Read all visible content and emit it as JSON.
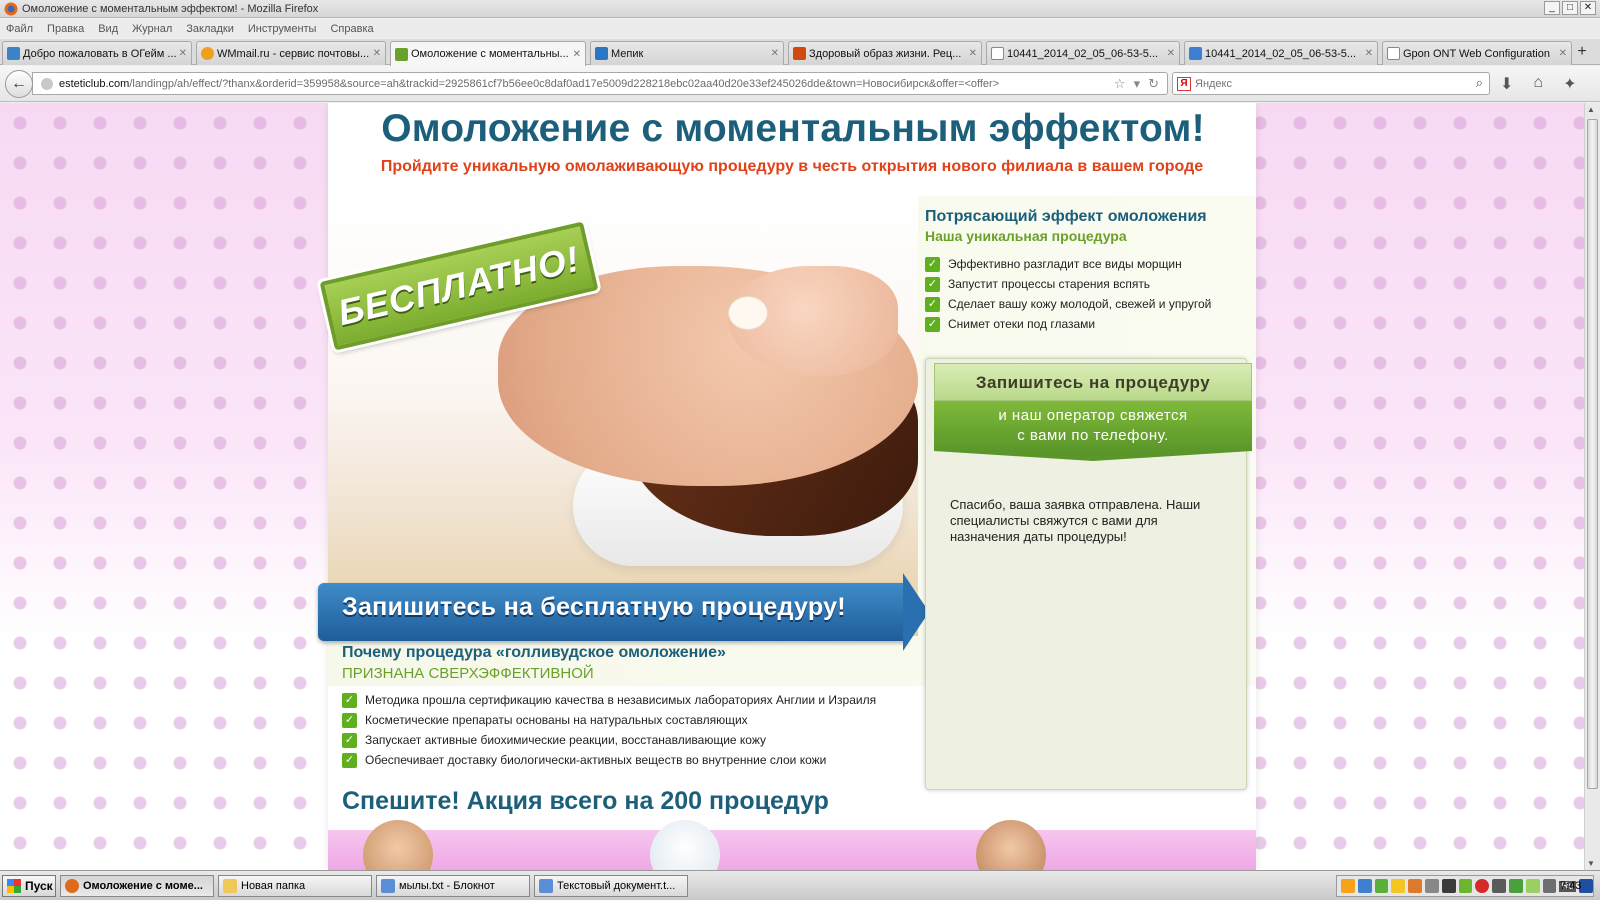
{
  "window": {
    "title": "Омоложение с моментальным эффектом! - Mozilla Firefox"
  },
  "menu": [
    "Файл",
    "Правка",
    "Вид",
    "Журнал",
    "Закладки",
    "Инструменты",
    "Справка"
  ],
  "tabs": [
    {
      "label": "Добро пожаловать в ОГейм ...",
      "color": "#3b83c7",
      "active": false
    },
    {
      "label": "WMmail.ru - сервис почтовы...",
      "color": "#f0a020",
      "active": false
    },
    {
      "label": "Омоложение с моментальны...",
      "color": "#6aa12a",
      "active": true
    },
    {
      "label": "Мепик",
      "color": "#2b75c5",
      "active": false
    },
    {
      "label": "Здоровый образ жизни. Рец...",
      "color": "#d04a10",
      "active": false
    },
    {
      "label": "10441_2014_02_05_06-53-5...",
      "color": "#cccccc",
      "active": false
    },
    {
      "label": "10441_2014_02_05_06-53-5...",
      "color": "#3d7fd1",
      "active": false
    },
    {
      "label": "Gpon ONT Web Configuration",
      "color": "#cccccc",
      "active": false
    }
  ],
  "nav": {
    "domain": "esteticlub.com",
    "path": "/landingp/ah/effect/?thanx&orderid=359958&source=ah&trackid=2925861cf7b56ee0c8daf0ad17e5009d228218ebc02aa40d20e33ef245026dde&town=Новосибирск&offer=<offer>",
    "search_placeholder": "Яндекс",
    "yandex_letter": "Я"
  },
  "page": {
    "headline": "Омоложение с моментальным эффектом!",
    "subline": "Пройдите уникальную омолаживающую процедуру в честь открытия нового филиала в вашем городе",
    "stamp": "БЕСПЛАТНО!",
    "effect_title": "Потрясающий эффект омоложения",
    "effect_subtitle": "Наша уникальная процедура",
    "benefits": [
      "Эффективно разгладит все виды морщин",
      "Запустит процессы старения вспять",
      "Сделает вашу кожу молодой, свежей и упругой",
      "Снимет отеки под глазами"
    ],
    "banner": "Запишитесь на бесплатную процедуру!",
    "form": {
      "title": "Запишитесь на процедуру",
      "subtitle_line1": "и наш оператор свяжется",
      "subtitle_line2": "с вами по телефону.",
      "thanks": "Спасибо, ваша заявка отправлена. Наши специалисты свяжутся с вами для назначения даты процедуры!"
    },
    "why_title": "Почему процедура «голливудское омоложение»",
    "why_subtitle": "ПРИЗНАНА СВЕРХЭФФЕКТИВНОЙ",
    "reasons": [
      "Методика прошла сертификацию качества в независимых лабораториях Англии и Израиля",
      "Косметические препараты основаны на натуральных составляющих",
      "Запускает активные биохимические реакции, восстанавливающие кожу",
      "Обеспечивает доставку биологически-активных веществ во внутренние слои кожи"
    ],
    "hurry": "Спешите! Акция всего на 200 процедур",
    "check_glyph": "✓"
  },
  "taskbar": {
    "start": "Пуск",
    "tasks": [
      {
        "label": "Омоложение с моме...",
        "color": "#e06a1b",
        "active": true
      },
      {
        "label": "Новая папка",
        "color": "#f0c85a",
        "active": false
      },
      {
        "label": "мылы.txt - Блокнот",
        "color": "#5a8fd8",
        "active": false
      },
      {
        "label": "Текстовый документ.t...",
        "color": "#5a8fd8",
        "active": false
      }
    ],
    "lang": "Ru",
    "clock": "7:43"
  }
}
